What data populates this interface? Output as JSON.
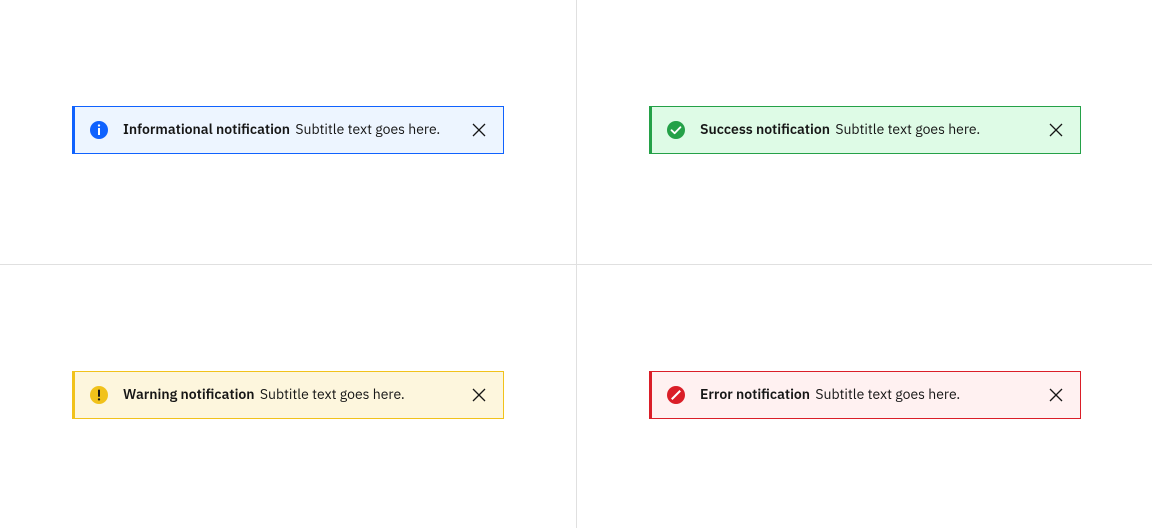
{
  "notifications": {
    "info": {
      "title": "Informational notification",
      "subtitle": "Subtitle text goes here.",
      "icon_color": "#0f62fe",
      "border_color": "#0f62fe",
      "background": "#edf5ff"
    },
    "success": {
      "title": "Success notification",
      "subtitle": "Subtitle text goes here.",
      "icon_color": "#24a148",
      "border_color": "#24a148",
      "background": "#defbe6"
    },
    "warning": {
      "title": "Warning notification",
      "subtitle": "Subtitle text goes here.",
      "icon_color": "#f1c21b",
      "border_color": "#f1c21b",
      "background": "#fdf6dd"
    },
    "error": {
      "title": "Error notification",
      "subtitle": "Subtitle text goes here.",
      "icon_color": "#da1e28",
      "border_color": "#da1e28",
      "background": "#fff1f1"
    }
  }
}
